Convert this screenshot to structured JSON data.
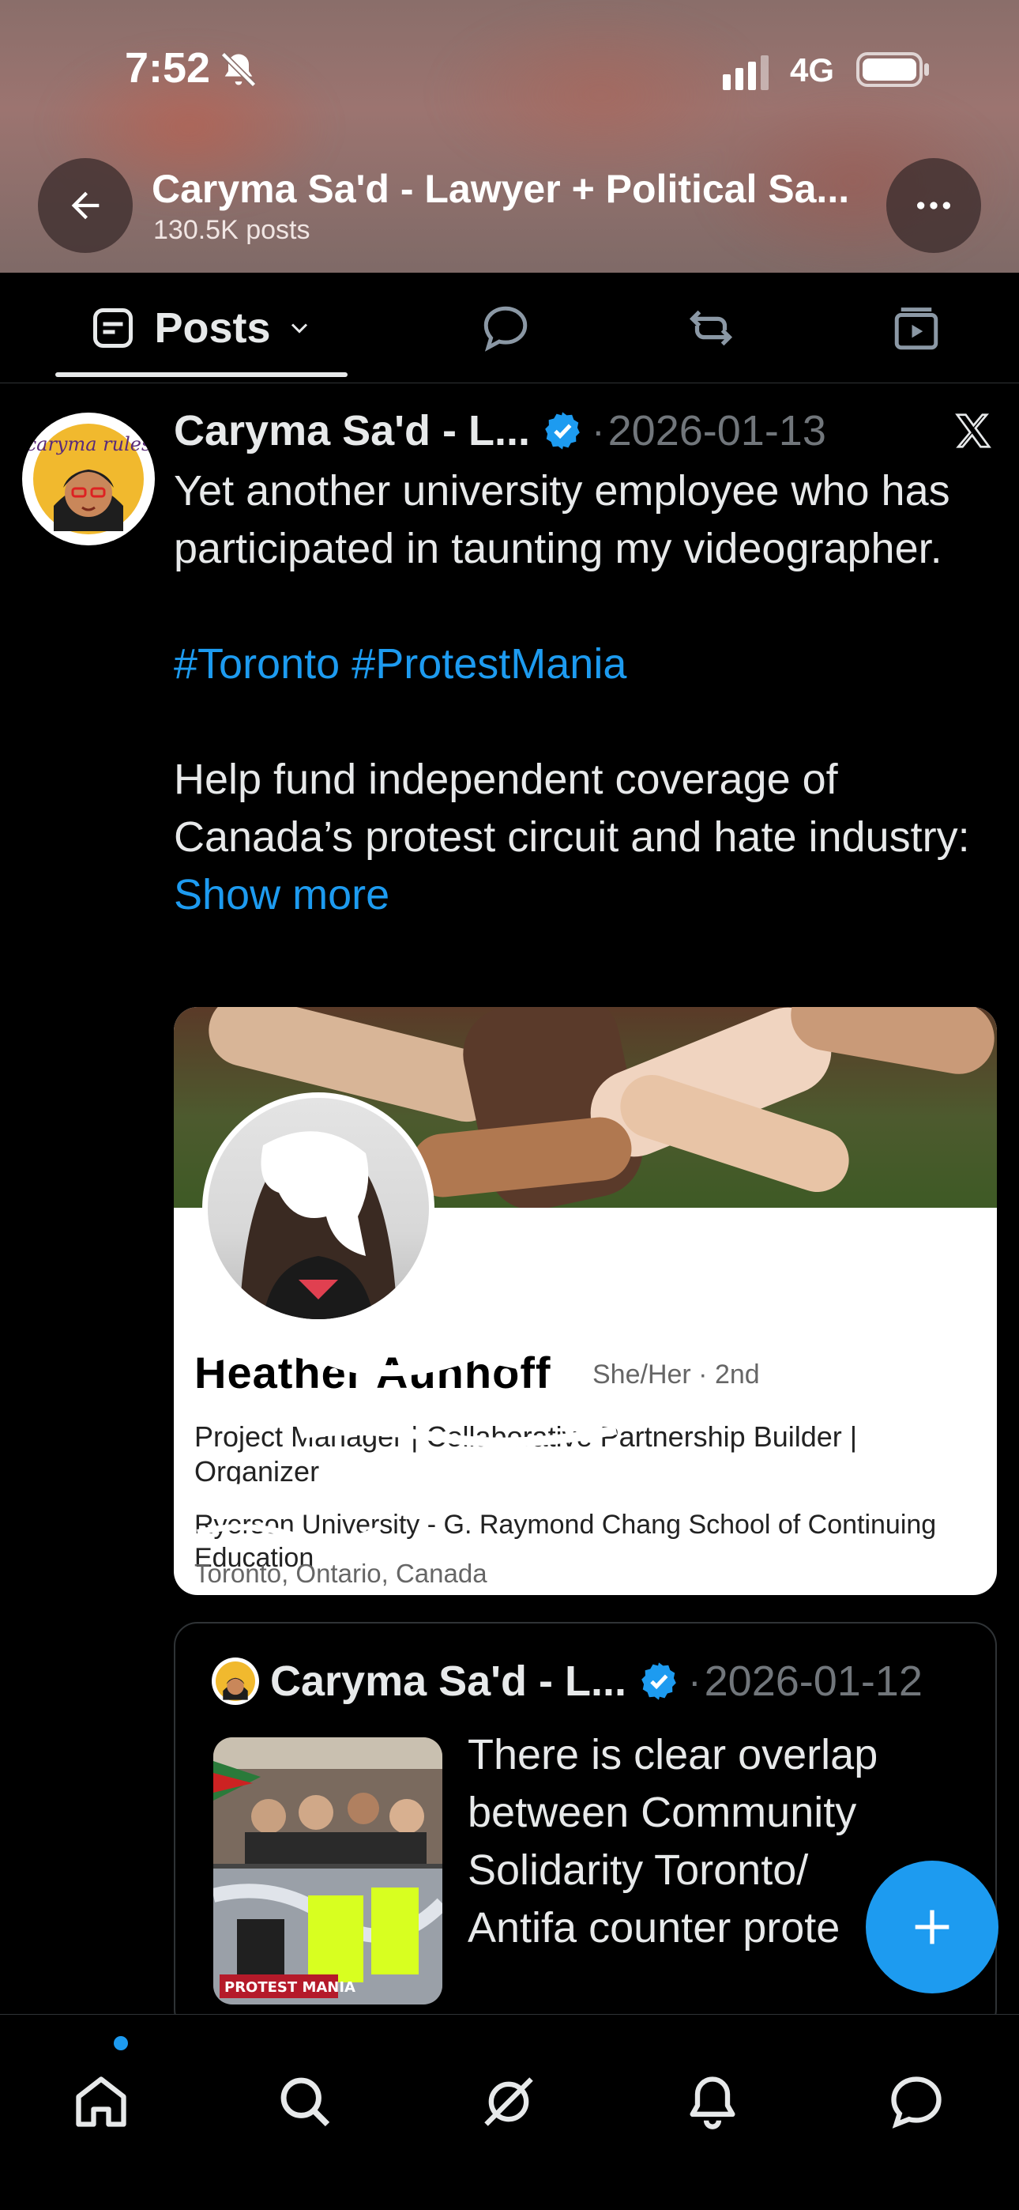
{
  "status_bar": {
    "time": "7:52",
    "network": "4G"
  },
  "header": {
    "title": "Caryma Sa'd - Lawyer + Political Sa...",
    "subtitle": "130.5K posts"
  },
  "tabs": [
    {
      "label": "Posts",
      "icon": "posts-icon",
      "active": true
    },
    {
      "label": "",
      "icon": "replies-icon",
      "active": false
    },
    {
      "label": "",
      "icon": "reposts-icon",
      "active": false
    },
    {
      "label": "",
      "icon": "media-icon",
      "active": false
    }
  ],
  "post": {
    "author": "Caryma Sa'd - L...",
    "date": "2026-01-13",
    "separator": "·",
    "avatar_text": "caryma rules",
    "line1": "Yet another university employee who has participated in taunting my videographer.",
    "hashtag1": "#Toronto",
    "hashtag2": "#ProtestMania",
    "line2": "Help fund independent coverage of Canada’s protest circuit and hate industry:",
    "show_more": "Show more",
    "image": {
      "name": "Heather Aunhoff",
      "pronouns": "She/Her · 2nd",
      "headline": "Project Manager | Collaborative Partnership Builder | Organizer",
      "organization": "Ryerson University - G. Raymond Chang School of Continuing Education",
      "location": "Toronto, Ontario, Canada"
    }
  },
  "quote": {
    "author": "Caryma Sa'd - L...",
    "date": "2026-01-12",
    "separator": "·",
    "text": "There is clear overlap\nbetween Community\nSolidarity Toronto/\nAntifa counter prote",
    "thumb_caption": "PROTEST MANIA"
  },
  "fab": {
    "icon": "plus-icon"
  },
  "bottom_nav": [
    {
      "icon": "home-icon",
      "has_badge": true
    },
    {
      "icon": "search-icon"
    },
    {
      "icon": "grok-icon"
    },
    {
      "icon": "bell-icon"
    },
    {
      "icon": "messages-icon"
    }
  ],
  "colors": {
    "accent": "#1d9bf0",
    "text": "#e7e9ea",
    "muted": "#71767b",
    "background": "#000000"
  }
}
